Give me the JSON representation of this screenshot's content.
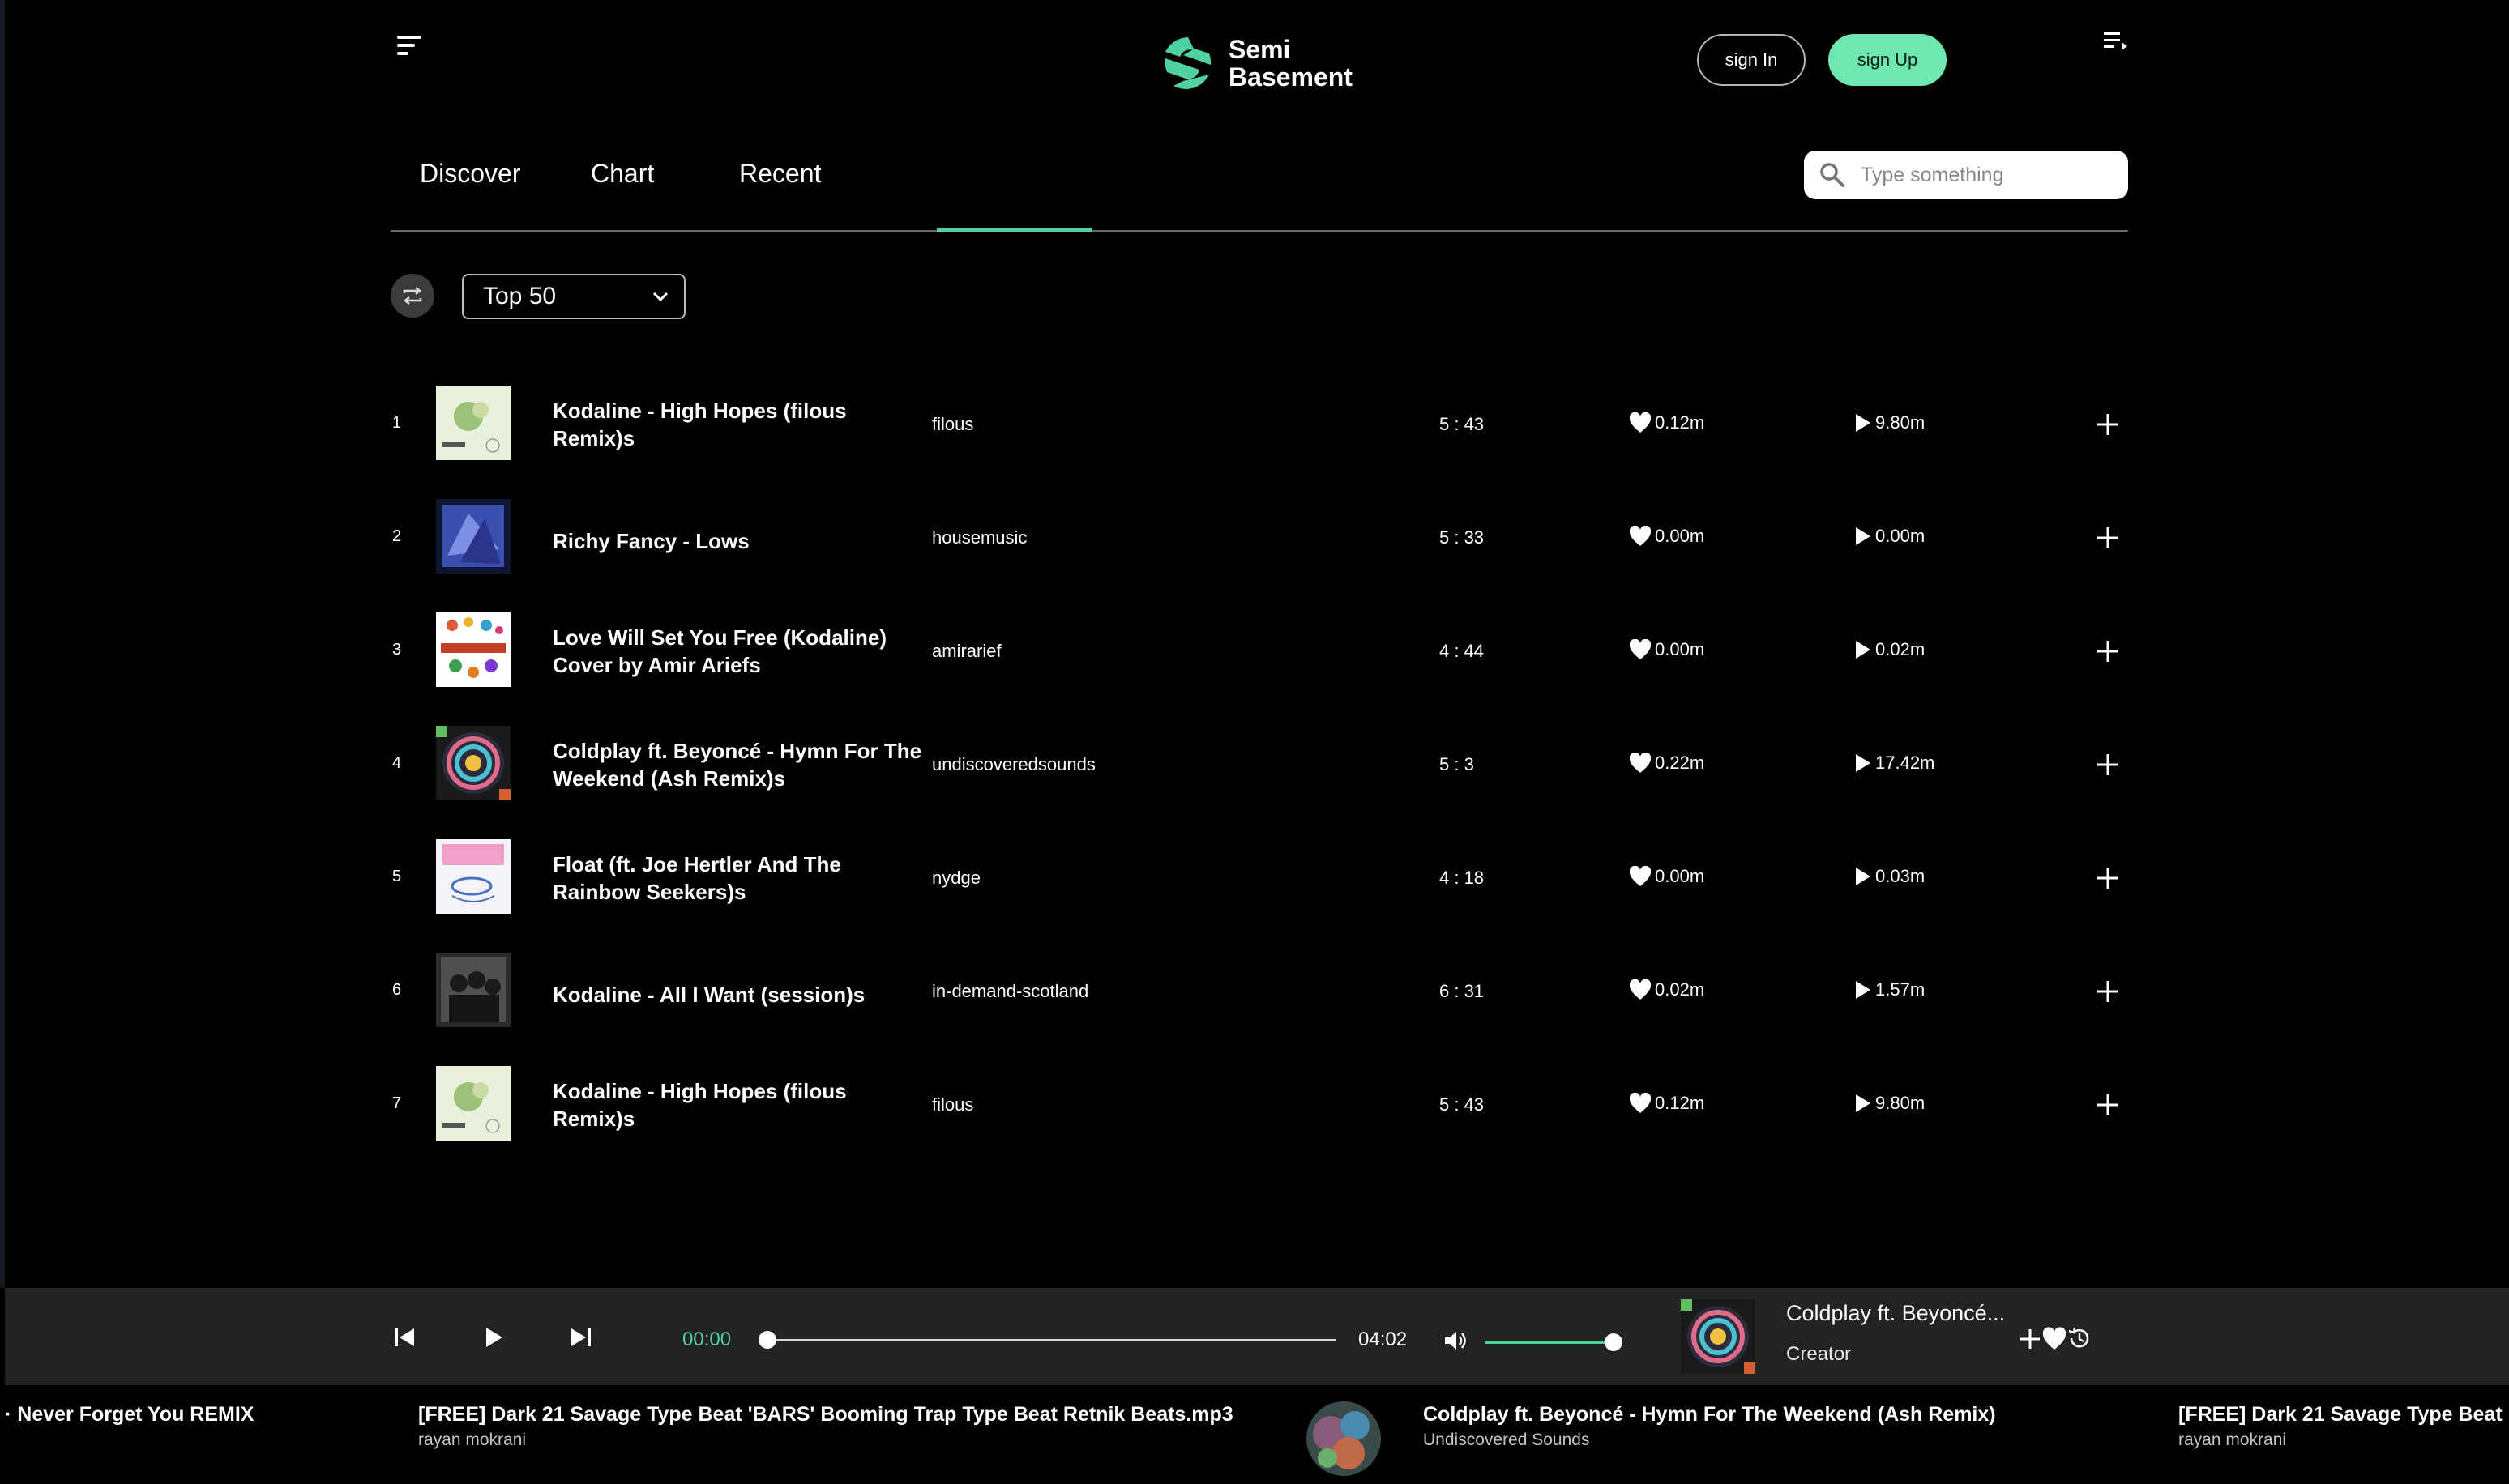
{
  "header": {
    "logo_line1": "Semi",
    "logo_line2": "Basement",
    "sign_in": "sign In",
    "sign_up": "sign Up"
  },
  "tabs": [
    {
      "label": "Discover"
    },
    {
      "label": "Chart",
      "active": true
    },
    {
      "label": "Recent"
    }
  ],
  "search": {
    "placeholder": "Type something"
  },
  "filter": {
    "selected": "Top 50"
  },
  "icons": [
    "menu-icon",
    "queue-icon",
    "search-icon",
    "repeat-icon",
    "chevron-down-icon",
    "heart-icon",
    "play-icon",
    "plus-icon",
    "skip-previous-icon",
    "skip-next-icon",
    "volume-icon",
    "history-icon"
  ],
  "accent_color": "#6ee7b0",
  "tracks": [
    {
      "num": "1",
      "title": "Kodaline - High Hopes (filous Remix)s",
      "artist": "filous",
      "duration": "5 : 43",
      "likes": "0.12m",
      "plays": "9.80m"
    },
    {
      "num": "2",
      "title": "Richy Fancy - Lows",
      "artist": "housemusic",
      "duration": "5 : 33",
      "likes": "0.00m",
      "plays": "0.00m"
    },
    {
      "num": "3",
      "title": "Love Will Set You Free (Kodaline) Cover by Amir Ariefs",
      "artist": "amirarief",
      "duration": "4 : 44",
      "likes": "0.00m",
      "plays": "0.02m"
    },
    {
      "num": "4",
      "title": "Coldplay ft. Beyoncé - Hymn For The Weekend (Ash Remix)s",
      "artist": "undiscoveredsounds",
      "duration": "5 : 3",
      "likes": "0.22m",
      "plays": "17.42m"
    },
    {
      "num": "5",
      "title": "Float (ft. Joe Hertler And The Rainbow Seekers)s",
      "artist": "nydge",
      "duration": "4 : 18",
      "likes": "0.00m",
      "plays": "0.03m"
    },
    {
      "num": "6",
      "title": "Kodaline - All I Want (session)s",
      "artist": "in-demand-scotland",
      "duration": "6 : 31",
      "likes": "0.02m",
      "plays": "1.57m"
    },
    {
      "num": "7",
      "title": "Kodaline - High Hopes (filous Remix)s",
      "artist": "filous",
      "duration": "5 : 43",
      "likes": "0.12m",
      "plays": "9.80m"
    }
  ],
  "player": {
    "current_time": "00:00",
    "total_time": "04:02",
    "progress": 0.0,
    "volume": 1.0,
    "now_playing_title": "Coldplay ft. Beyoncé...",
    "now_playing_subtitle": "Creator"
  },
  "ticker": [
    {
      "title": "· Never Forget You REMIX",
      "sub": ""
    },
    {
      "title": "[FREE] Dark 21 Savage Type Beat 'BARS' Booming Trap Type Beat Retnik Beats.mp3",
      "sub": "rayan mokrani"
    },
    {
      "title": "Coldplay ft. Beyoncé - Hymn For The Weekend (Ash Remix)",
      "sub": "Undiscovered Sounds"
    },
    {
      "title": "[FREE] Dark 21 Savage Type Beat",
      "sub": "rayan mokrani"
    }
  ]
}
